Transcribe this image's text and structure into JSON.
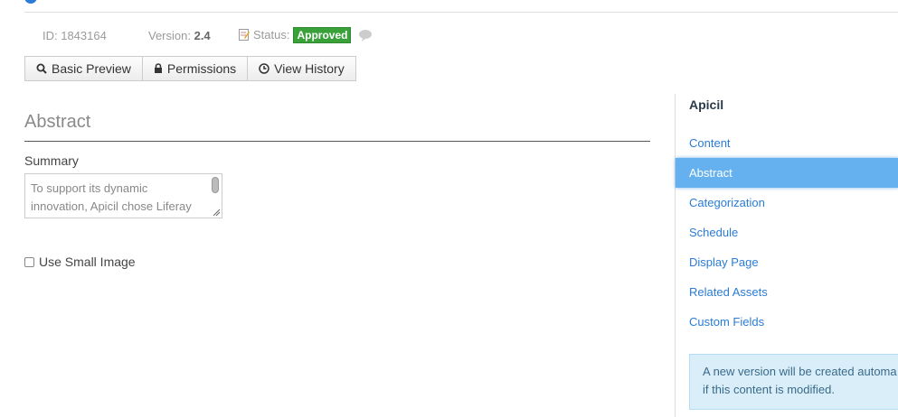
{
  "meta": {
    "id_text": "ID: 1843164",
    "version_label": "Version: ",
    "version_value": "2.4",
    "status_label": "Status:",
    "status_badge": "Approved",
    "badge_color": "#3aa13a"
  },
  "toolbar": {
    "basic_preview": "Basic Preview",
    "permissions": "Permissions",
    "view_history": "View History"
  },
  "abstract": {
    "title": "Abstract",
    "summary_label": "Summary",
    "summary_text": "To support its dynamic innovation, Apicil chose Liferay",
    "use_small_image_label": "Use Small Image",
    "use_small_image_checked": false
  },
  "panel": {
    "title": "Apicil",
    "items": [
      {
        "label": "Content",
        "active": false
      },
      {
        "label": "Abstract",
        "active": true
      },
      {
        "label": "Categorization",
        "active": false
      },
      {
        "label": "Schedule",
        "active": false
      },
      {
        "label": "Display Page",
        "active": false
      },
      {
        "label": "Related Assets",
        "active": false
      },
      {
        "label": "Custom Fields",
        "active": false
      }
    ],
    "info_line1": "A new version will be created automa",
    "info_line2": "if this content is modified.",
    "accent_color": "#2a7cd6",
    "active_color": "#65b1ef"
  }
}
